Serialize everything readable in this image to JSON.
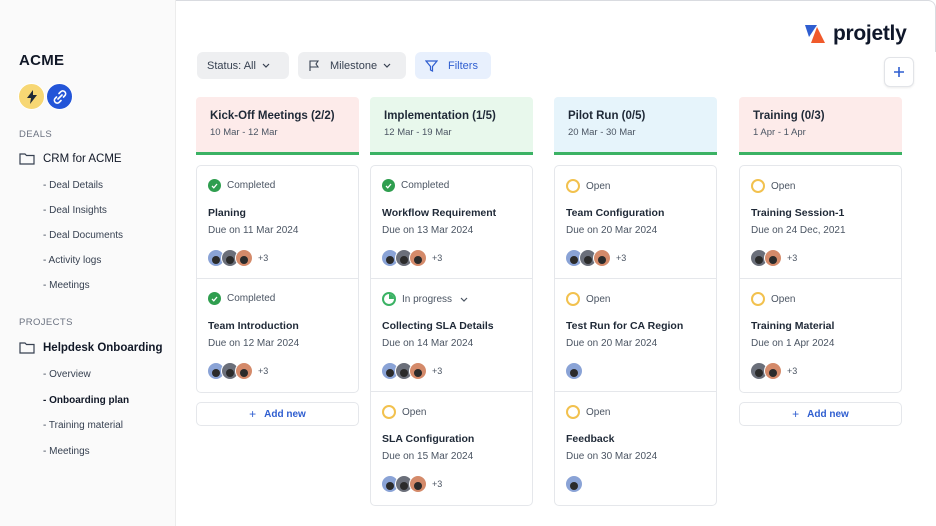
{
  "sidebar": {
    "brand": "ACME",
    "deals_label": "DEALS",
    "deal_group": "CRM for ACME",
    "deal_items": [
      "- Deal Details",
      "- Deal Insights",
      "- Deal Documents",
      "- Activity logs",
      "- Meetings"
    ],
    "projects_label": "PROJECTS",
    "project_group": "Helpdesk Onboarding",
    "project_items": [
      "- Overview",
      "- Onboarding plan",
      "- Training material",
      "- Meetings"
    ],
    "active_item": "- Onboarding plan"
  },
  "logo": {
    "text": "projetly"
  },
  "toolbar": {
    "status_label": "Status: All",
    "milestone_label": "Milestone",
    "filters_label": "Filters"
  },
  "add_new_label": "Add new",
  "columns": [
    {
      "title": "Kick-Off Meetings (2/2)",
      "range": "10 Mar - 12 Mar",
      "color": "#fdebea",
      "cards": [
        {
          "status": "Completed",
          "state": "done",
          "title": "Planing",
          "due": "Due on 11 Mar 2024",
          "avatars": 3,
          "more": "+3"
        },
        {
          "status": "Completed",
          "state": "done",
          "title": "Team Introduction",
          "due": "Due on 12 Mar 2024",
          "avatars": 3,
          "more": "+3"
        }
      ],
      "add_new": true
    },
    {
      "title": "Implementation (1/5)",
      "range": "12 Mar - 19 Mar",
      "color": "#e8f8ec",
      "cards": [
        {
          "status": "Completed",
          "state": "done",
          "title": "Workflow Requirement",
          "due": "Due on 13 Mar 2024",
          "avatars": 3,
          "more": "+3"
        },
        {
          "status": "In progress",
          "state": "progress",
          "title": "Collecting SLA Details",
          "due": "Due on 14 Mar 2024",
          "avatars": 3,
          "more": "+3"
        },
        {
          "status": "Open",
          "state": "open",
          "title": "SLA Configuration",
          "due": "Due on 15 Mar 2024",
          "avatars": 3,
          "more": "+3"
        }
      ],
      "add_new": false
    },
    {
      "title": "Pilot Run (0/5)",
      "range": "20 Mar - 30 Mar",
      "color": "#e6f4fb",
      "cards": [
        {
          "status": "Open",
          "state": "open",
          "title": "Team Configuration",
          "due": "Due on 20 Mar 2024",
          "avatars": 3,
          "more": "+3"
        },
        {
          "status": "Open",
          "state": "open",
          "title": "Test Run for CA Region",
          "due": "Due on 20 Mar 2024",
          "avatars": 1,
          "more": ""
        },
        {
          "status": "Open",
          "state": "open",
          "title": "Feedback",
          "due": "Due on 30 Mar 2024",
          "avatars": 1,
          "more": ""
        }
      ],
      "add_new": false
    },
    {
      "title": "Training (0/3)",
      "range": "1 Apr - 1 Apr",
      "color": "#fdebea",
      "cards": [
        {
          "status": "Open",
          "state": "open",
          "title": "Training Session-1",
          "due": "Due on 24 Dec, 2021",
          "avatars": 2,
          "more": "+3"
        },
        {
          "status": "Open",
          "state": "open",
          "title": "Training Material",
          "due": "Due on 1 Apr 2024",
          "avatars": 2,
          "more": "+3"
        }
      ],
      "add_new": true
    }
  ]
}
